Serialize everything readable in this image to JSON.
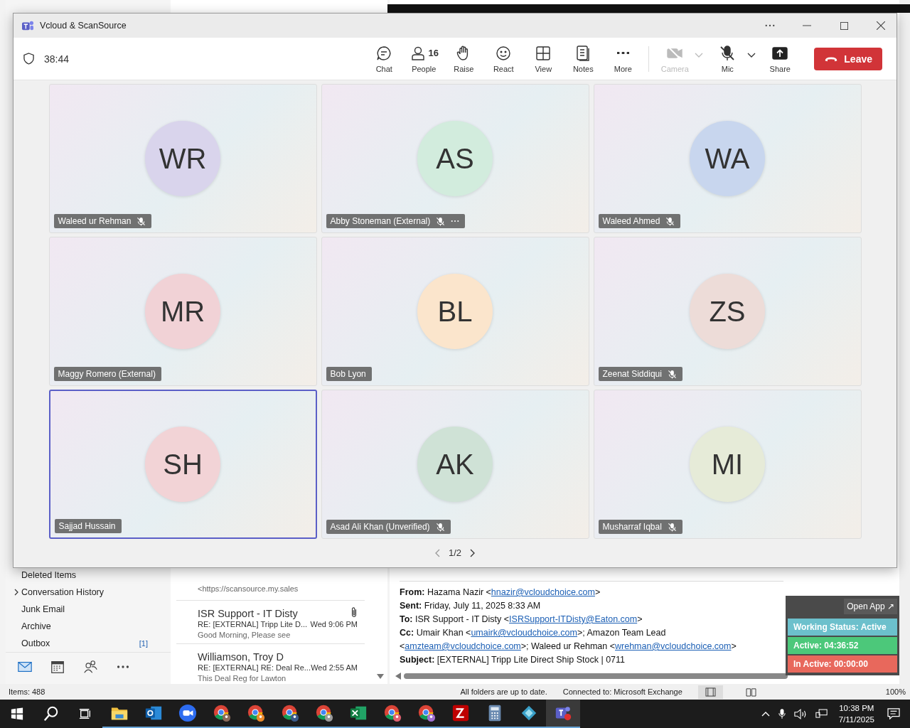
{
  "window": {
    "title": "Vcloud & ScanSource"
  },
  "meeting": {
    "duration": "38:44"
  },
  "toolbar": [
    {
      "kind": "chat",
      "label": "Chat",
      "disabled": false
    },
    {
      "kind": "people",
      "label": "People",
      "count": "16",
      "disabled": false
    },
    {
      "kind": "raise",
      "label": "Raise",
      "disabled": false
    },
    {
      "kind": "react",
      "label": "React",
      "disabled": false
    },
    {
      "kind": "view",
      "label": "View",
      "disabled": false
    },
    {
      "kind": "notes",
      "label": "Notes",
      "disabled": false
    },
    {
      "kind": "more",
      "label": "More",
      "disabled": false
    },
    {
      "kind": "camera",
      "label": "Camera",
      "disabled": true
    },
    {
      "kind": "mic",
      "label": "Mic",
      "disabled": false
    },
    {
      "kind": "share",
      "label": "Share",
      "disabled": false
    }
  ],
  "leave_button": {
    "label": "Leave"
  },
  "participants": [
    {
      "initials": "WR",
      "name": "Waleed ur Rehman",
      "muted": true,
      "selected": false,
      "more": false,
      "color": "#d9d4ec"
    },
    {
      "initials": "AS",
      "name": "Abby Stoneman (External)",
      "muted": true,
      "selected": false,
      "more": true,
      "color": "#d2ecdd"
    },
    {
      "initials": "WA",
      "name": "Waleed Ahmed",
      "muted": true,
      "selected": false,
      "more": false,
      "color": "#c8d6ee"
    },
    {
      "initials": "MR",
      "name": "Maggy Romero (External)",
      "muted": false,
      "selected": false,
      "more": false,
      "color": "#f1d2d6"
    },
    {
      "initials": "BL",
      "name": "Bob Lyon",
      "muted": false,
      "selected": false,
      "more": false,
      "color": "#fbe5cc"
    },
    {
      "initials": "ZS",
      "name": "Zeenat Siddiqui",
      "muted": true,
      "selected": false,
      "more": false,
      "color": "#eddcd8"
    },
    {
      "initials": "SH",
      "name": "Sajjad Hussain",
      "muted": false,
      "selected": true,
      "more": false,
      "color": "#f2d3d6"
    },
    {
      "initials": "AK",
      "name": "Asad Ali Khan (Unverified)",
      "muted": true,
      "selected": false,
      "more": false,
      "color": "#cfe2d6"
    },
    {
      "initials": "MI",
      "name": "Musharraf Iqbal",
      "muted": true,
      "selected": false,
      "more": false,
      "color": "#e6ebd8"
    }
  ],
  "pager": {
    "page": "1/2"
  },
  "folders": [
    {
      "name": "Deleted Items"
    },
    {
      "name": "Conversation History",
      "expanded": false
    },
    {
      "name": "Junk Email"
    },
    {
      "name": "Archive"
    },
    {
      "name": "Outbox",
      "count": "[1]"
    }
  ],
  "nav": [
    {
      "kind": "mail",
      "selected": true
    },
    {
      "kind": "calendar",
      "selected": false
    },
    {
      "kind": "people",
      "selected": false
    },
    {
      "kind": "more",
      "selected": false
    }
  ],
  "messages": [
    {
      "preview": "<https://scansource.my.sales"
    },
    {
      "sender": "ISR Support - IT Disty",
      "subject": "RE: [EXTERNAL] Tripp Lite D...",
      "date": "Wed 9:06 PM",
      "preview": "Good Morning,  Please see",
      "attachment": true
    },
    {
      "sender": "Williamson, Troy D",
      "subject": "RE: [EXTERNAL] RE: Deal Re...",
      "date": "Wed 2:55 AM",
      "preview": "This Deal Reg for Lawton",
      "attachment": false
    }
  ],
  "email_header": [
    {
      "label": "From:",
      "parts": [
        {
          "text": " Hazama Nazir <"
        },
        {
          "link": "hnazir@vcloudchoice.com"
        },
        {
          "text": ">"
        }
      ]
    },
    {
      "label": "Sent:",
      "parts": [
        {
          "text": " Friday, July 11, 2025 8:33 AM"
        }
      ]
    },
    {
      "label": "To:",
      "parts": [
        {
          "text": " ISR Support - IT Disty <"
        },
        {
          "link": "ISRSupport-ITDisty@Eaton.com"
        },
        {
          "text": ">"
        }
      ]
    },
    {
      "label": "Cc:",
      "parts": [
        {
          "text": " Umair Khan <"
        },
        {
          "link": "umairk@vcloudchoice.com"
        },
        {
          "text": ">; Amazon Team Lead <"
        },
        {
          "link": "amzteam@vcloudchoice.com"
        },
        {
          "text": ">; Waleed ur Rehman <"
        },
        {
          "link": "wrehman@vcloudchoice.com"
        },
        {
          "text": ">"
        }
      ]
    },
    {
      "label": "Subject:",
      "parts": [
        {
          "text": " [EXTERNAL] Tripp Lite Direct Ship Stock | 0711"
        }
      ]
    }
  ],
  "status_bar": {
    "items": "Items: 488",
    "sync": "All folders are up to date.",
    "connection": "Connected to: Microsoft Exchange",
    "zoom": "100%"
  },
  "tracker": {
    "open_app": "Open App ↗",
    "rows": [
      {
        "text": "Working Status: Active",
        "color": "#6cc0cc"
      },
      {
        "text": "Active: 04:36:52",
        "color": "#4cc87a"
      },
      {
        "text": "In Active: 00:00:00",
        "color": "#e8685c"
      }
    ]
  },
  "taskbar": {
    "apps": [
      {
        "kind": "folder",
        "active": false
      },
      {
        "kind": "outlook",
        "active": false
      },
      {
        "kind": "zoom",
        "active": false
      },
      {
        "kind": "chrome",
        "color": "#8a6a5a",
        "active": false
      },
      {
        "kind": "chrome",
        "color": "#e8892b",
        "active": false
      },
      {
        "kind": "chrome",
        "color": "#3a5a8a",
        "active": false
      },
      {
        "kind": "chrome",
        "color": "#9a9a9a",
        "active": false
      },
      {
        "kind": "excel",
        "active": false
      },
      {
        "kind": "chrome",
        "color": "#e06070",
        "active": false
      },
      {
        "kind": "chrome",
        "color": "#a070d0",
        "active": false
      },
      {
        "kind": "filezilla",
        "active": false
      },
      {
        "kind": "calculator",
        "active": false
      },
      {
        "kind": "diamond",
        "active": false
      },
      {
        "kind": "teams",
        "active": true
      }
    ],
    "time": "10:38 PM",
    "date": "7/11/2025"
  }
}
